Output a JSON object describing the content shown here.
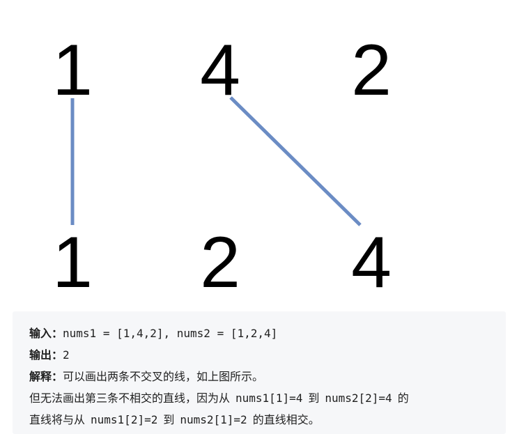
{
  "diagram": {
    "top_row": [
      "1",
      "4",
      "2"
    ],
    "bottom_row": [
      "1",
      "2",
      "4"
    ],
    "connections": [
      {
        "from_top": 0,
        "to_bottom": 0
      },
      {
        "from_top": 1,
        "to_bottom": 2
      }
    ],
    "line_color": "#6b8cc4"
  },
  "explanation": {
    "input_label": "输入：",
    "input_value": "nums1 = [1,4,2], nums2 = [1,2,4]",
    "output_label": "输出：",
    "output_value": "2",
    "explain_label": "解释：",
    "explain_text": "可以画出两条不交叉的线，如上图所示。",
    "line4_a": "但无法画出第三条不相交的直线，因为从",
    "line4_code1": "nums1[1]=4",
    "line4_b": "到",
    "line4_code2": "nums2[2]=4",
    "line4_c": "的",
    "line5_a": "直线将与从",
    "line5_code1": "nums1[2]=2",
    "line5_b": "到",
    "line5_code2": "nums2[1]=2",
    "line5_c": "的直线相交。"
  }
}
